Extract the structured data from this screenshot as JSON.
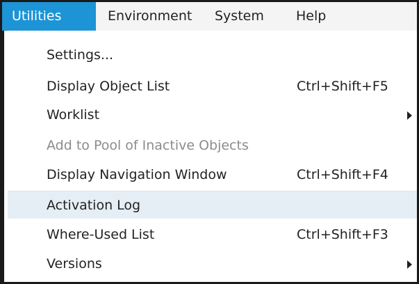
{
  "menubar": {
    "items": [
      {
        "label": "Utilities",
        "active": true
      },
      {
        "label": "Environment"
      },
      {
        "label": "System"
      },
      {
        "label": "Help"
      }
    ]
  },
  "dropdown": {
    "items": [
      {
        "label": "Settings...",
        "shortcut": "",
        "submenu": false,
        "enabled": true
      },
      {
        "label": "Display Object List",
        "shortcut": "Ctrl+Shift+F5",
        "submenu": false,
        "enabled": true
      },
      {
        "label": "Worklist",
        "shortcut": "",
        "submenu": true,
        "enabled": true
      },
      {
        "label": "Add to Pool of Inactive Objects",
        "shortcut": "",
        "submenu": false,
        "enabled": false
      },
      {
        "label": "Display Navigation Window",
        "shortcut": "Ctrl+Shift+F4",
        "submenu": false,
        "enabled": true
      },
      {
        "label": "Activation Log",
        "shortcut": "",
        "submenu": false,
        "enabled": true,
        "hovered": true
      },
      {
        "label": "Where-Used List",
        "shortcut": "Ctrl+Shift+F3",
        "submenu": false,
        "enabled": true
      },
      {
        "label": "Versions",
        "shortcut": "",
        "submenu": true,
        "enabled": true
      }
    ]
  },
  "colors": {
    "active_menu_bg": "#1d94d6",
    "hover_row_bg": "#e6eef5",
    "disabled_text": "#8c8c8c"
  }
}
